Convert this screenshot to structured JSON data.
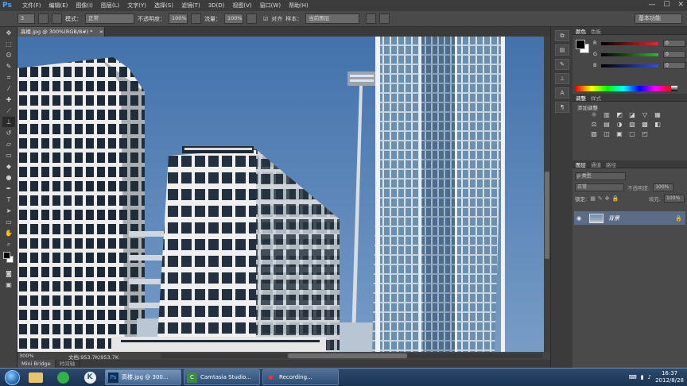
{
  "app": {
    "logo": "Ps",
    "menu": [
      "文件(F)",
      "编辑(E)",
      "图像(I)",
      "图层(L)",
      "文字(Y)",
      "选择(S)",
      "滤镜(T)",
      "3D(D)",
      "视图(V)",
      "窗口(W)",
      "帮助(H)"
    ],
    "window_controls": [
      "—",
      "☐",
      "✕"
    ]
  },
  "options": {
    "brush_size": "3",
    "mode_label": "模式：",
    "mode_value": "正常",
    "opacity_label": "不透明度：",
    "opacity_value": "100%",
    "flow_label": "流量：",
    "flow_value": "100%",
    "align_label": "对齐",
    "sample_label": "样本：",
    "sample_value": "当前图层",
    "workspace": "基本功能"
  },
  "document": {
    "tab_title": "高楼.jpg @ 300%(RGB/8#) *",
    "zoom": "300%",
    "doc_info": "文档:953.7K/953.7K"
  },
  "mini_bridge": {
    "tabs": [
      "Mini Bridge",
      "时间轴"
    ]
  },
  "panels": {
    "color": {
      "tabs": [
        "颜色",
        "色板"
      ],
      "channels": [
        {
          "name": "R",
          "value": "0",
          "color": "#d93030"
        },
        {
          "name": "G",
          "value": "0",
          "color": "#2fb52f"
        },
        {
          "name": "B",
          "value": "0",
          "color": "#2f53d9"
        }
      ]
    },
    "adjustments": {
      "tabs": [
        "调整",
        "样式"
      ],
      "title": "添加调整",
      "icons": [
        "☼",
        "▥",
        "◩",
        "◪",
        "▽",
        "▦",
        "⚖",
        "▤",
        "◑",
        "▧",
        "▩",
        "◧",
        "▨",
        "◫",
        "▣",
        "▢",
        "◰"
      ]
    },
    "layers": {
      "tabs": [
        "图层",
        "通道",
        "路径"
      ],
      "filter_label": "ρ 类型",
      "blend_mode": "正常",
      "opacity_label": "不透明度:",
      "opacity_value": "100%",
      "lock_label": "锁定:",
      "fill_label": "填充:",
      "fill_value": "100%",
      "layer_name": "背景"
    }
  },
  "taskbar": {
    "buttons": [
      {
        "label": "高楼.jpg @ 300...",
        "icon": "Ps"
      },
      {
        "label": "Camtasia Studio...",
        "icon": "C"
      },
      {
        "label": "Recording...",
        "icon": "●"
      }
    ],
    "time": "16:37",
    "date": "2012/8/28"
  }
}
